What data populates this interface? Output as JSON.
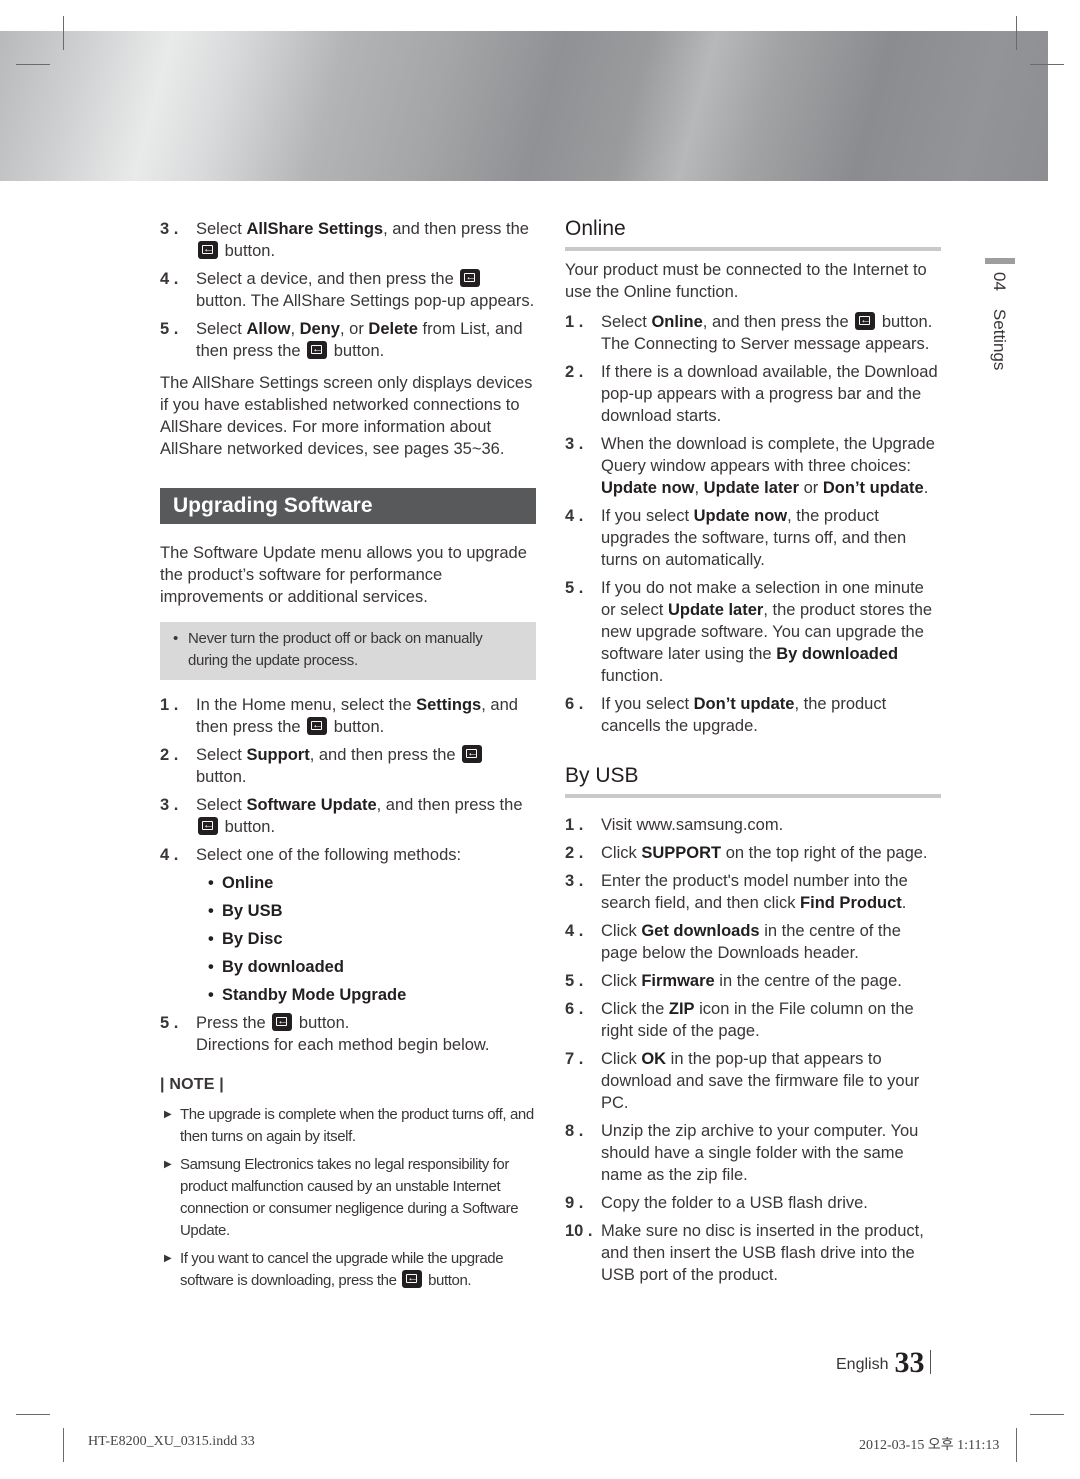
{
  "left_column": {
    "allshare_steps": [
      {
        "num": "3 .",
        "parts": [
          "Select ",
          "AllShare Settings",
          ", and then press the ",
          "button."
        ]
      },
      {
        "num": "4 .",
        "parts": [
          "Select a device, and then press the ",
          "button. The AllShare Settings pop-up appears."
        ]
      },
      {
        "num": "5 .",
        "parts": [
          "Select ",
          "Allow",
          ", ",
          "Deny",
          ", or ",
          "Delete",
          " from List, and then press the ",
          "button."
        ]
      }
    ],
    "allshare_note": "The AllShare Settings screen only displays devices if you have established networked connections to AllShare devices. For more information about AllShare networked devices, see pages 35~36.",
    "section_title": "Upgrading Software",
    "intro": "The Software Update menu allows you to upgrade the product’s software for performance improvements or additional services.",
    "caution": "Never turn the product off or back on manually during the update process.",
    "steps": [
      {
        "num": "1 .",
        "parts": [
          "In the Home menu, select the ",
          "Settings",
          ", and then press the ",
          "button."
        ]
      },
      {
        "num": "2 .",
        "parts": [
          "Select ",
          "Support",
          ", and then press the ",
          "button."
        ]
      },
      {
        "num": "3 .",
        "parts": [
          "Select ",
          "Software Update",
          ", and then press the ",
          "button."
        ]
      },
      {
        "num": "4 .",
        "parts": [
          "Select one of the following methods:"
        ]
      }
    ],
    "methods": [
      "Online",
      "By USB",
      "By Disc",
      "By downloaded",
      "Standby Mode Upgrade"
    ],
    "step5": {
      "num": "5 .",
      "parts": [
        "Press the ",
        "button.",
        "Directions for each method begin below."
      ]
    },
    "note_title": "| NOTE |",
    "notes": [
      "The upgrade is complete when the product turns off, and then turns on again by itself.",
      "Samsung Electronics takes no legal responsibility for product malfunction caused by an unstable Internet connection or consumer negligence during a Software Update.",
      {
        "before": "If you want to cancel the upgrade while the upgrade software is downloading, press the ",
        "after": "button."
      }
    ]
  },
  "right_column": {
    "online": {
      "title": "Online",
      "intro": "Your product must be connected to the Internet to use the Online function.",
      "steps": [
        {
          "num": "1 .",
          "parts": [
            "Select ",
            "Online",
            ", and then press the ",
            "button. The Connecting to Server message appears."
          ]
        },
        {
          "num": "2 .",
          "parts": [
            "If there is a download available, the Download pop-up appears with a progress bar and the download starts."
          ]
        },
        {
          "num": "3 .",
          "parts": [
            "When the download is complete, the Upgrade Query window appears with three choices: ",
            "Update now",
            ", ",
            "Update later",
            " or ",
            "Don’t update",
            "."
          ]
        },
        {
          "num": "4 .",
          "parts": [
            "If you select ",
            "Update now",
            ", the product upgrades the software, turns off, and then turns on automatically."
          ]
        },
        {
          "num": "5 .",
          "parts": [
            "If you do not make a selection in one minute or select ",
            "Update later",
            ", the product stores the new upgrade software. You can upgrade the software later using the ",
            "By downloaded",
            " function."
          ]
        },
        {
          "num": "6 .",
          "parts": [
            "If you select ",
            "Don’t update",
            ", the product cancells the upgrade."
          ]
        }
      ]
    },
    "usb": {
      "title": "By USB",
      "steps": [
        {
          "num": "1 .",
          "parts": [
            "Visit www.samsung.com."
          ]
        },
        {
          "num": "2 .",
          "parts": [
            "Click ",
            "SUPPORT",
            " on the top right of the page."
          ]
        },
        {
          "num": "3 .",
          "parts": [
            "Enter the product's model number into the search field, and then click ",
            "Find Product",
            "."
          ]
        },
        {
          "num": "4 .",
          "parts": [
            "Click ",
            "Get downloads",
            " in the centre of the page below the Downloads header."
          ]
        },
        {
          "num": "5 .",
          "parts": [
            "Click ",
            "Firmware",
            " in the centre of the page."
          ]
        },
        {
          "num": "6 .",
          "parts": [
            "Click the ",
            "ZIP",
            " icon in the File column on the right side of the page."
          ]
        },
        {
          "num": "7 .",
          "parts": [
            "Click ",
            "OK",
            " in the pop-up that appears to download and save the firmware file to your PC."
          ]
        },
        {
          "num": "8 .",
          "parts": [
            "Unzip the zip archive to your computer. You should have a single folder with the same name as the zip file."
          ]
        },
        {
          "num": "9 .",
          "parts": [
            "Copy the folder to a USB flash drive."
          ]
        },
        {
          "num": "10 .",
          "parts": [
            "Make sure no disc is inserted in the product, and then insert the USB flash drive into the USB port of the product."
          ]
        }
      ]
    }
  },
  "side_tab": {
    "chapter": "04",
    "label": "Settings"
  },
  "footer": {
    "language": "English",
    "page_number": "33",
    "slug_file": "HT-E8200_XU_0315.indd   33",
    "slug_date": "2012-03-15   오후 1:11:13"
  },
  "icons": {
    "enter_button": "enter-button-icon",
    "bullet": "bullet-icon",
    "note_arrow": "triangle-right-icon"
  },
  "colors": {
    "section_bar": "#58595b",
    "caution_bg": "#d9d9da",
    "heading_rule": "#c8c9ca",
    "text": "#3a3536"
  }
}
